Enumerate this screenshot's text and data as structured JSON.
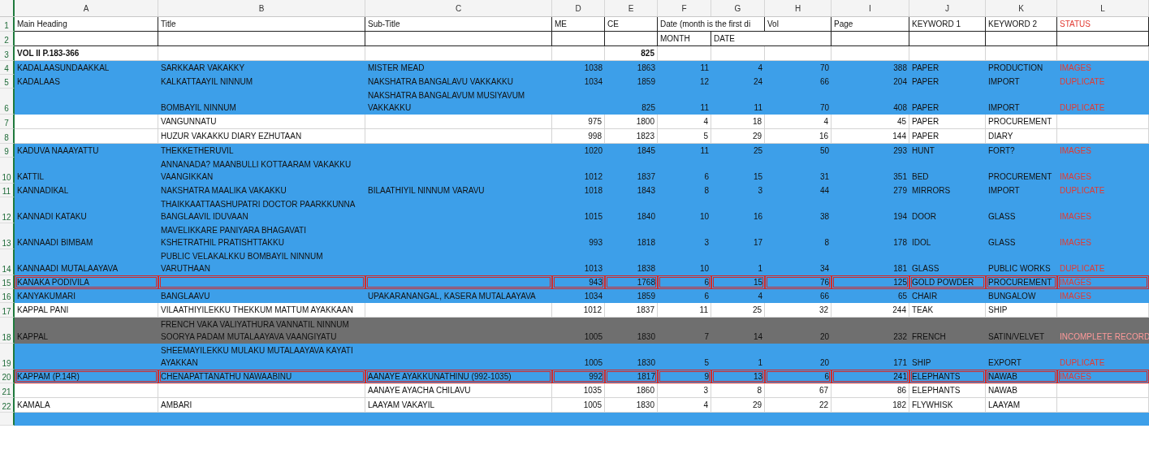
{
  "columns": [
    {
      "letter": "A",
      "kind": "text"
    },
    {
      "letter": "B",
      "kind": "text"
    },
    {
      "letter": "C",
      "kind": "text"
    },
    {
      "letter": "D",
      "kind": "number"
    },
    {
      "letter": "E",
      "kind": "number"
    },
    {
      "letter": "F",
      "kind": "number"
    },
    {
      "letter": "G",
      "kind": "number"
    },
    {
      "letter": "H",
      "kind": "number"
    },
    {
      "letter": "I",
      "kind": "number"
    },
    {
      "letter": "J",
      "kind": "text"
    },
    {
      "letter": "K",
      "kind": "text"
    },
    {
      "letter": "L",
      "kind": "status"
    }
  ],
  "rows": [
    {
      "number": "1",
      "kind": "header",
      "color": "#ffffff",
      "outlined": false,
      "bold": false,
      "cells": [
        "Main Heading",
        "Title",
        "Sub-Title",
        "ME",
        "CE",
        "Date (month is the first di",
        "",
        "Vol",
        "Page",
        "KEYWORD 1",
        "KEYWORD 2",
        "STATUS"
      ]
    },
    {
      "number": "2",
      "kind": "header",
      "color": "#ffffff",
      "outlined": false,
      "bold": false,
      "cells": [
        "",
        "",
        "",
        "",
        "",
        "MONTH",
        "DATE",
        "",
        "",
        "",
        "",
        ""
      ]
    },
    {
      "number": "3",
      "kind": "data",
      "color": "#ffffff",
      "outlined": false,
      "bold": true,
      "cells": [
        "VOL II P.183-366",
        "",
        "",
        "",
        "825",
        "",
        "",
        "",
        "",
        "",
        "",
        ""
      ]
    },
    {
      "number": "4",
      "kind": "data",
      "color": "#3d9fe9",
      "outlined": false,
      "bold": false,
      "cells": [
        "KADALAASUNDAAKKAL",
        "SARKKAAR VAKAKKY",
        "MISTER MEAD",
        "1038",
        "1863",
        "11",
        "4",
        "70",
        "388",
        "PAPER",
        "PRODUCTION",
        "IMAGES"
      ]
    },
    {
      "number": "5",
      "kind": "data",
      "color": "#3d9fe9",
      "outlined": false,
      "bold": false,
      "cells": [
        "KADALAAS",
        "KALKATTAAYIL NINNUM",
        "NAKSHATRA BANGALAVU VAKKAKKU",
        "1034",
        "1859",
        "12",
        "24",
        "66",
        "204",
        "PAPER",
        "IMPORT",
        "DUPLICATE"
      ]
    },
    {
      "number": "6",
      "kind": "data",
      "color": "#3d9fe9",
      "outlined": false,
      "bold": false,
      "cells": [
        "",
        "BOMBAYIL NINNUM",
        "NAKSHATRA BANGALAVUM MUSIYAVUM VAKKAKKU",
        "",
        "825",
        "11",
        "11",
        "70",
        "408",
        "PAPER",
        "IMPORT",
        "DUPLICATE"
      ]
    },
    {
      "number": "7",
      "kind": "data",
      "color": "#ffffff",
      "outlined": false,
      "bold": false,
      "cells": [
        "",
        "VANGUNNATU",
        "",
        "975",
        "1800",
        "4",
        "18",
        "4",
        "45",
        "PAPER",
        "PROCUREMENT",
        ""
      ]
    },
    {
      "number": "8",
      "kind": "data",
      "color": "#ffffff",
      "outlined": false,
      "bold": false,
      "cells": [
        "",
        "HUZUR VAKAKKU DIARY EZHUTAAN",
        "",
        "998",
        "1823",
        "5",
        "29",
        "16",
        "144",
        "PAPER",
        "DIARY",
        ""
      ]
    },
    {
      "number": "9",
      "kind": "data",
      "color": "#3d9fe9",
      "outlined": false,
      "bold": false,
      "cells": [
        "KADUVA NAAAYATTU",
        "THEKKETHERUVIL",
        "",
        "1020",
        "1845",
        "11",
        "25",
        "50",
        "293",
        "HUNT",
        "FORT?",
        "IMAGES"
      ]
    },
    {
      "number": "10",
      "kind": "data",
      "color": "#3d9fe9",
      "outlined": false,
      "bold": false,
      "cells": [
        "KATTIL",
        "ANNANADA? MAANBULLI KOTTAARAM VAKAKKU VAANGIKKAN",
        "",
        "1012",
        "1837",
        "6",
        "15",
        "31",
        "351",
        "BED",
        "PROCUREMENT",
        "IMAGES"
      ]
    },
    {
      "number": "11",
      "kind": "data",
      "color": "#3d9fe9",
      "outlined": false,
      "bold": false,
      "cells": [
        "KANNADIKAL",
        "NAKSHATRA MAALIKA VAKAKKU",
        "BILAATHIYIL NINNUM VARAVU",
        "1018",
        "1843",
        "8",
        "3",
        "44",
        "279",
        "MIRRORS",
        "IMPORT",
        "DUPLICATE"
      ]
    },
    {
      "number": "12",
      "kind": "data",
      "color": "#3d9fe9",
      "outlined": false,
      "bold": false,
      "cells": [
        "KANNADI KATAKU",
        "THAIKKAATTAASHUPATRI DOCTOR PAARKKUNNA BANGLAAVIL IDUVAAN",
        "",
        "1015",
        "1840",
        "10",
        "16",
        "38",
        "194",
        "DOOR",
        "GLASS",
        "IMAGES"
      ]
    },
    {
      "number": "13",
      "kind": "data",
      "color": "#3d9fe9",
      "outlined": false,
      "bold": false,
      "cells": [
        "KANNAADI BIMBAM",
        "MAVELIKKARE PANIYARA BHAGAVATI KSHETRATHIL PRATISHTTAKKU",
        "",
        "993",
        "1818",
        "3",
        "17",
        "8",
        "178",
        "IDOL",
        "GLASS",
        "IMAGES"
      ]
    },
    {
      "number": "14",
      "kind": "data",
      "color": "#3d9fe9",
      "outlined": false,
      "bold": false,
      "cells": [
        "KANNAADI MUTALAAYAVA",
        "PUBLIC VELAKALKKU BOMBAYIL NINNUM VARUTHAAN",
        "",
        "1013",
        "1838",
        "10",
        "1",
        "34",
        "181",
        "GLASS",
        "PUBLIC WORKS",
        "DUPLICATE"
      ]
    },
    {
      "number": "15",
      "kind": "data",
      "color": "#3d9fe9",
      "outlined": true,
      "bold": false,
      "cells": [
        "KANAKA PODIVILA",
        "",
        "",
        "943",
        "1768",
        "6",
        "15",
        "76",
        "125",
        "GOLD POWDER",
        "PROCUREMENT",
        "IMAGES"
      ]
    },
    {
      "number": "16",
      "kind": "data",
      "color": "#3d9fe9",
      "outlined": false,
      "bold": false,
      "cells": [
        "KANYAKUMARI",
        "BANGLAAVU",
        "UPAKARANANGAL, KASERA MUTALAAYAVA",
        "1034",
        "1859",
        "6",
        "4",
        "66",
        "65",
        "CHAIR",
        "BUNGALOW",
        "IMAGES"
      ]
    },
    {
      "number": "17",
      "kind": "data",
      "color": "#ffffff",
      "outlined": false,
      "bold": false,
      "cells": [
        "KAPPAL PANI",
        "VILAATHIYILEKKU THEKKUM MATTUM AYAKKAAN",
        "",
        "1012",
        "1837",
        "11",
        "25",
        "32",
        "244",
        "TEAK",
        "SHIP",
        ""
      ]
    },
    {
      "number": "18",
      "kind": "data",
      "color": "#6f6f6f",
      "outlined": false,
      "bold": false,
      "cells": [
        "KAPPAL",
        "FRENCH VAKA VALIYATHURA VANNATIL NINNUM SOORYA PADAM MUTALAAYAVA VAANGIYATU",
        "",
        "1005",
        "1830",
        "7",
        "14",
        "20",
        "232",
        "FRENCH",
        "SATIN/VELVET",
        "INCOMPLETE RECORD"
      ]
    },
    {
      "number": "19",
      "kind": "data",
      "color": "#3d9fe9",
      "outlined": false,
      "bold": false,
      "cells": [
        "",
        "SHEEMAYILEKKU MULAKU MUTALAAYAVA KAYATI AYAKKAN",
        "",
        "1005",
        "1830",
        "5",
        "1",
        "20",
        "171",
        "SHIP",
        "EXPORT",
        "DUPLICATE"
      ]
    },
    {
      "number": "20",
      "kind": "data",
      "color": "#3d9fe9",
      "outlined": true,
      "bold": false,
      "cells": [
        "KAPPAM (P.14R)",
        "CHENAPATTANATHU NAWAABINU",
        "AANAYE AYAKKUNATHINU (992-1035)",
        "992",
        "1817",
        "9",
        "13",
        "6",
        "241",
        "ELEPHANTS",
        "NAWAB",
        "IMAGES"
      ]
    },
    {
      "number": "21",
      "kind": "data",
      "color": "#ffffff",
      "outlined": false,
      "bold": false,
      "cells": [
        "",
        "",
        "AANAYE AYACHA CHILAVU",
        "1035",
        "1860",
        "3",
        "8",
        "67",
        "86",
        "ELEPHANTS",
        "NAWAB",
        ""
      ]
    },
    {
      "number": "22",
      "kind": "data",
      "color": "#ffffff",
      "outlined": false,
      "bold": false,
      "cells": [
        "KAMALA",
        "AMBARI",
        "LAAYAM VAKAYIL",
        "1005",
        "1830",
        "4",
        "29",
        "22",
        "182",
        "FLYWHISK",
        "LAAYAM",
        ""
      ]
    },
    {
      "kind": "data",
      "color": "#3d9fe9",
      "cells": []
    }
  ]
}
